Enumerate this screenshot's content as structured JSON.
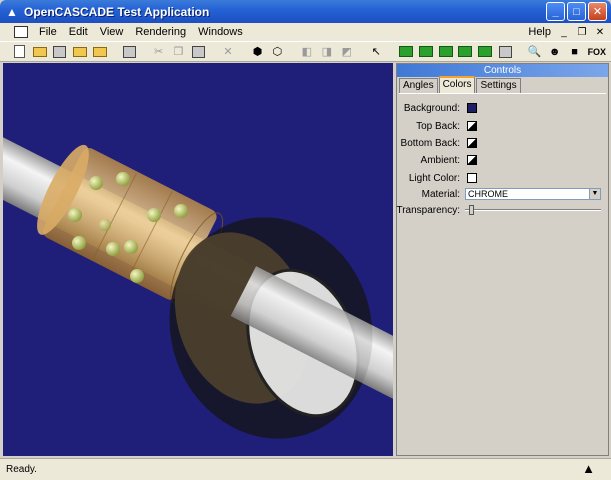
{
  "window": {
    "title": "OpenCASCADE Test Application",
    "minimize": "_",
    "maximize": "□",
    "close": "✕"
  },
  "menu": {
    "items": [
      "File",
      "Edit",
      "View",
      "Rendering",
      "Windows"
    ],
    "help": "Help",
    "doc_min": "_",
    "doc_restore": "❐",
    "doc_close": "✕"
  },
  "toolbar": {
    "fox_label": "FOX"
  },
  "controls": {
    "title": "Controls",
    "close": "✕",
    "tabs": [
      "Angles",
      "Colors",
      "Settings"
    ],
    "active_tab": "Colors",
    "fields": {
      "background": "Background:",
      "top_back": "Top Back:",
      "bottom_back": "Bottom Back:",
      "ambient": "Ambient:",
      "light_color": "Light Color:",
      "material": "Material:",
      "transparency": "Transparency:"
    },
    "material_value": "CHROME",
    "transparency_value": 0.02
  },
  "status": {
    "text": "Ready."
  },
  "colors": {
    "viewport_bg": "#1f1f7a",
    "title_bar": "#2563d6",
    "tab_accent": "#f2a32d"
  }
}
